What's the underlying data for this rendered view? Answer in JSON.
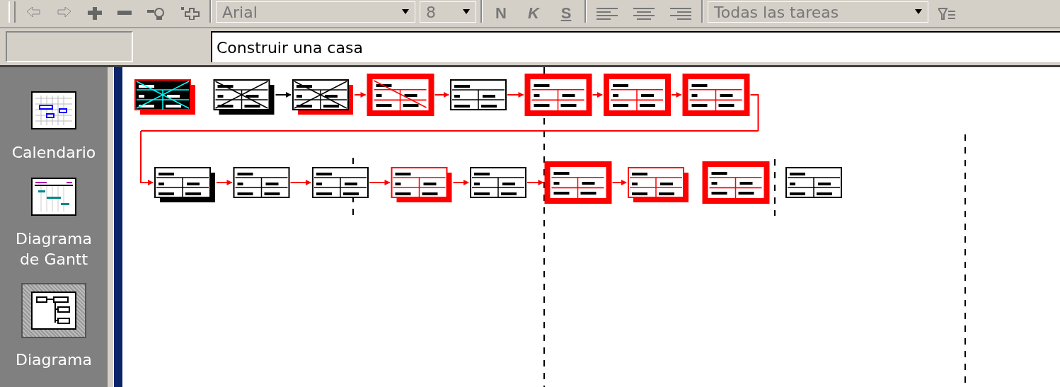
{
  "toolbar": {
    "font": "Arial",
    "size": "8",
    "bold": "N",
    "italic": "K",
    "underline": "S",
    "filter": "Todas las tareas"
  },
  "entry_bar": {
    "value": "Construir una casa"
  },
  "view_bar": {
    "items": [
      {
        "label": "Calendario",
        "kind": "calendar",
        "selected": false
      },
      {
        "label": "Diagrama de Gantt",
        "kind": "gantt",
        "selected": false
      },
      {
        "label": "Diagrama",
        "kind": "pert",
        "selected": true
      }
    ]
  },
  "pert": {
    "rows": [
      [
        {
          "kind": "summary",
          "critical": true,
          "complete": true,
          "selected": true,
          "linked": false
        },
        {
          "kind": "summary",
          "critical": false,
          "complete": true,
          "selected": false,
          "linked": true,
          "link_critical": false
        },
        {
          "kind": "summary",
          "critical": true,
          "complete": true,
          "selected": false,
          "linked": true,
          "link_critical": true
        },
        {
          "kind": "milestone",
          "critical": true,
          "complete": true,
          "selected": false,
          "linked": true,
          "link_critical": true
        },
        {
          "kind": "task",
          "critical": false,
          "complete": false,
          "selected": false,
          "linked": true,
          "link_critical": true
        },
        {
          "kind": "milestone",
          "critical": true,
          "complete": false,
          "selected": false,
          "linked": true,
          "link_critical": true
        },
        {
          "kind": "milestone",
          "critical": true,
          "complete": false,
          "selected": false,
          "linked": true,
          "link_critical": true
        },
        {
          "kind": "milestone",
          "critical": true,
          "complete": false,
          "selected": false,
          "linked": true,
          "link_critical": true
        }
      ],
      [
        {
          "kind": "summary",
          "critical": false,
          "complete": false,
          "selected": false,
          "linked": true,
          "link_critical": true
        },
        {
          "kind": "task",
          "critical": false,
          "complete": false,
          "selected": false,
          "linked": true,
          "link_critical": true
        },
        {
          "kind": "task",
          "critical": false,
          "complete": false,
          "selected": false,
          "linked": true,
          "link_critical": true
        },
        {
          "kind": "summary",
          "critical": true,
          "complete": false,
          "selected": false,
          "linked": true,
          "link_critical": true
        },
        {
          "kind": "task",
          "critical": false,
          "complete": false,
          "selected": false,
          "linked": true,
          "link_critical": true
        },
        {
          "kind": "milestone",
          "critical": true,
          "complete": false,
          "selected": false,
          "linked": true,
          "link_critical": true
        },
        {
          "kind": "summary",
          "critical": true,
          "complete": false,
          "selected": false,
          "linked": false
        },
        {
          "kind": "milestone",
          "critical": true,
          "complete": false,
          "selected": false,
          "linked": false
        },
        {
          "kind": "task",
          "critical": false,
          "complete": false,
          "selected": false
        }
      ]
    ]
  }
}
